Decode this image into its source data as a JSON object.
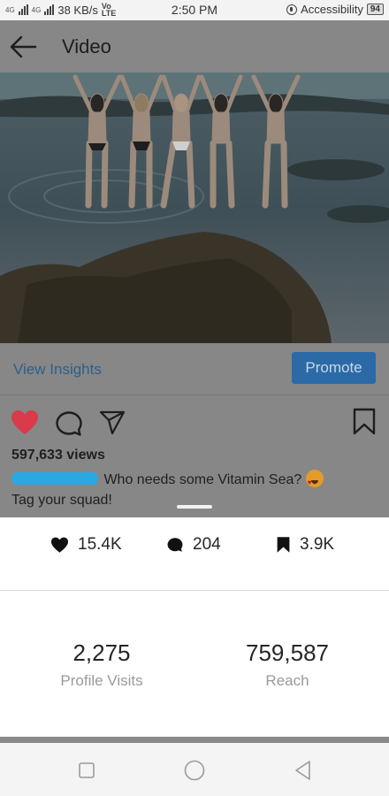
{
  "status_bar": {
    "network_left": "4G",
    "network_right": "4G",
    "speed": "38 KB/s",
    "volte_top": "Vo",
    "volte_bottom": "LTE",
    "time": "2:50 PM",
    "accessibility": "Accessibility",
    "battery": "94"
  },
  "header": {
    "title": "Video"
  },
  "post": {
    "view_insights": "View Insights",
    "promote": "Promote",
    "views": "597,633 views",
    "caption_line1": "Who needs some Vitamin Sea?",
    "caption_line2": "Tag your squad!"
  },
  "insights": {
    "likes": "15.4K",
    "comments": "204",
    "saves": "3.9K",
    "profile_visits_value": "2,275",
    "profile_visits_label": "Profile Visits",
    "reach_value": "759,587",
    "reach_label": "Reach"
  },
  "colors": {
    "like_red": "#d93b4a",
    "promote_blue": "#2b6aa6",
    "link_blue": "#2b5f8c",
    "redaction": "#29a9e3"
  },
  "icons": {
    "back": "arrow-left-icon",
    "like": "heart-icon",
    "comment": "comment-bubble-icon",
    "share": "paper-plane-icon",
    "save": "bookmark-icon",
    "nav_recent": "square-icon",
    "nav_home": "circle-icon",
    "nav_back": "triangle-back-icon"
  }
}
